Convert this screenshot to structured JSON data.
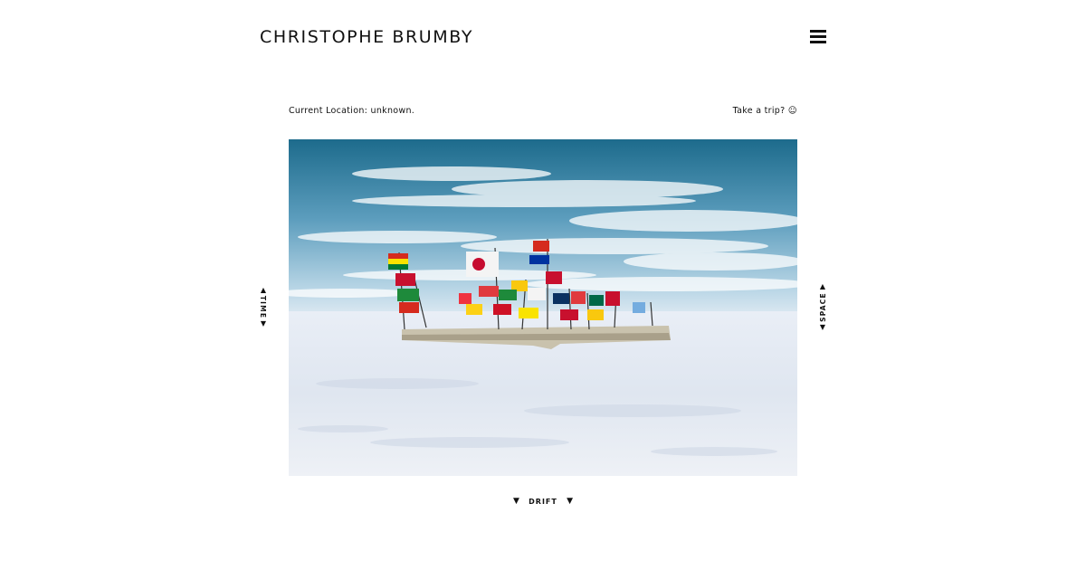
{
  "header": {
    "title": "CHRISTOPHE BRUMBY",
    "menu_icon": "hamburger-menu-icon"
  },
  "info_bar": {
    "location_text": "Current Location: unknown.",
    "trip_link_text": "Take a trip? ☺"
  },
  "photo": {
    "icon": "photograph-salt-flat-flags",
    "colors": {
      "sky_top": "#1f6f8e",
      "sky_bottom": "#a9cde0",
      "ground": "#e8edf4"
    }
  },
  "navigation": {
    "time": {
      "label": "TIME",
      "arrow_up": "▲",
      "arrow_down": "▼"
    },
    "space": {
      "label": "SPACE",
      "arrow_up": "▲",
      "arrow_down": "▼"
    },
    "drift": {
      "label": "DRIFT",
      "arrow_left": "▼",
      "arrow_right": "▼"
    }
  }
}
